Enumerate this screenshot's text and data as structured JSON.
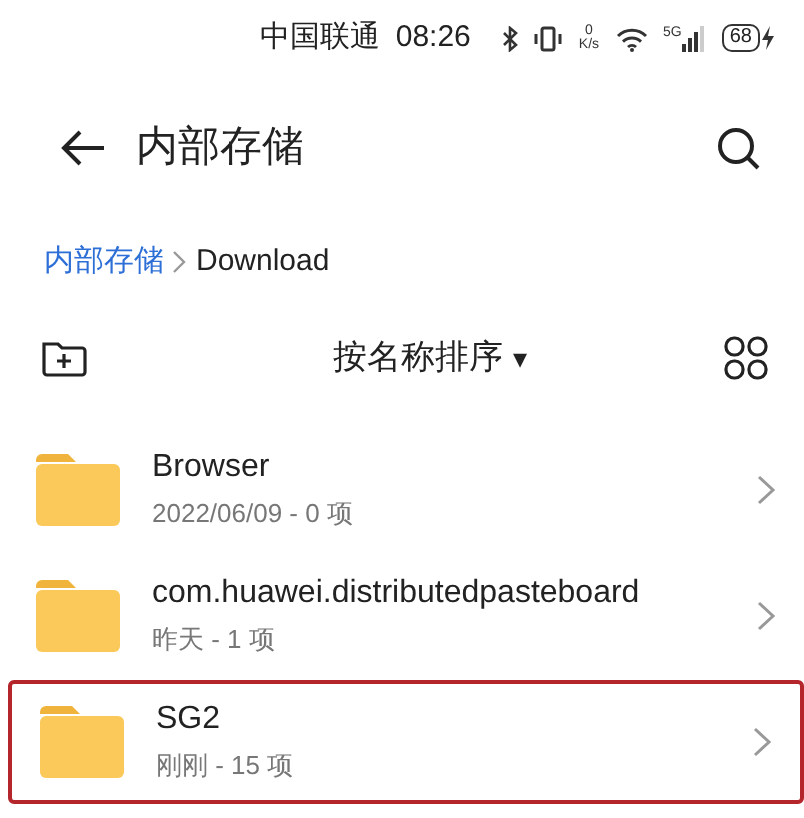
{
  "status_bar": {
    "carrier": "中国联通",
    "time": "08:26",
    "net_speed_value": "0",
    "net_speed_unit": "K/s",
    "network": "5G",
    "battery": "68"
  },
  "header": {
    "title": "内部存储"
  },
  "breadcrumb": [
    {
      "label": "内部存储",
      "selected": false
    },
    {
      "label": "Download",
      "selected": true
    }
  ],
  "toolbar": {
    "sort_label": "按名称排序",
    "sort_caret": "▾"
  },
  "files": [
    {
      "name": "Browser",
      "meta": "2022/06/09 - 0 项",
      "highlighted": false
    },
    {
      "name": "com.huawei.distributedpasteboard",
      "meta": "昨天 - 1 项",
      "highlighted": false
    },
    {
      "name": "SG2",
      "meta": "刚刚 - 15 项",
      "highlighted": true
    }
  ]
}
